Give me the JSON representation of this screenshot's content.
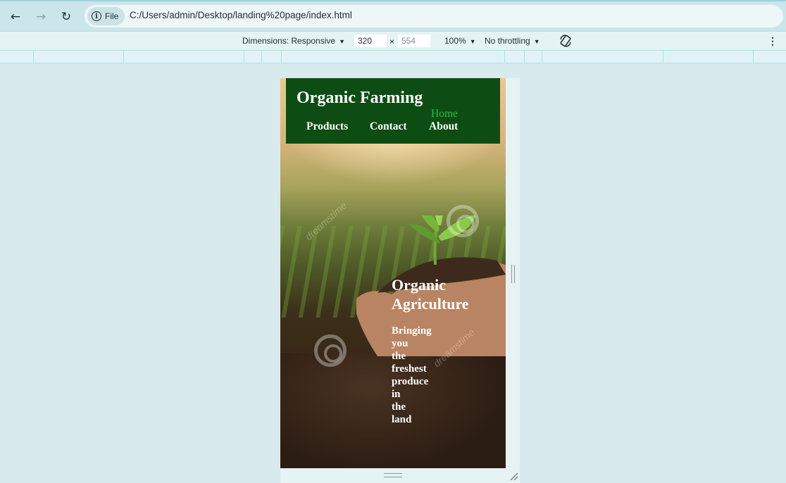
{
  "browser": {
    "back_icon": "arrow-left-icon",
    "forward_icon": "arrow-right-icon",
    "reload_icon": "reload-icon",
    "site_chip_label": "File",
    "url": "C:/Users/admin/Desktop/landing%20page/index.html"
  },
  "devtools": {
    "dimensions_label": "Dimensions: Responsive",
    "width_value": "320",
    "height_value": "554",
    "times_sign": "×",
    "zoom_label": "100%",
    "throttle_label": "No throttling",
    "rotate_icon": "rotate-icon",
    "menu_icon": "more-vertical-icon"
  },
  "page": {
    "site_title": "Organic Farming",
    "nav": {
      "home": "Home",
      "products": "Products",
      "contact": "Contact",
      "about": "About"
    },
    "hero_title_line1": "Organic",
    "hero_title_line2": "Agriculture",
    "hero_words": [
      "Bringing",
      "you",
      "the",
      "freshest",
      "produce",
      "in",
      "the",
      "land"
    ],
    "watermark_text": "dreamstime",
    "colors": {
      "header_bg": "#0d4d13",
      "active_link": "#2fb84a",
      "text": "#ffffff"
    }
  }
}
